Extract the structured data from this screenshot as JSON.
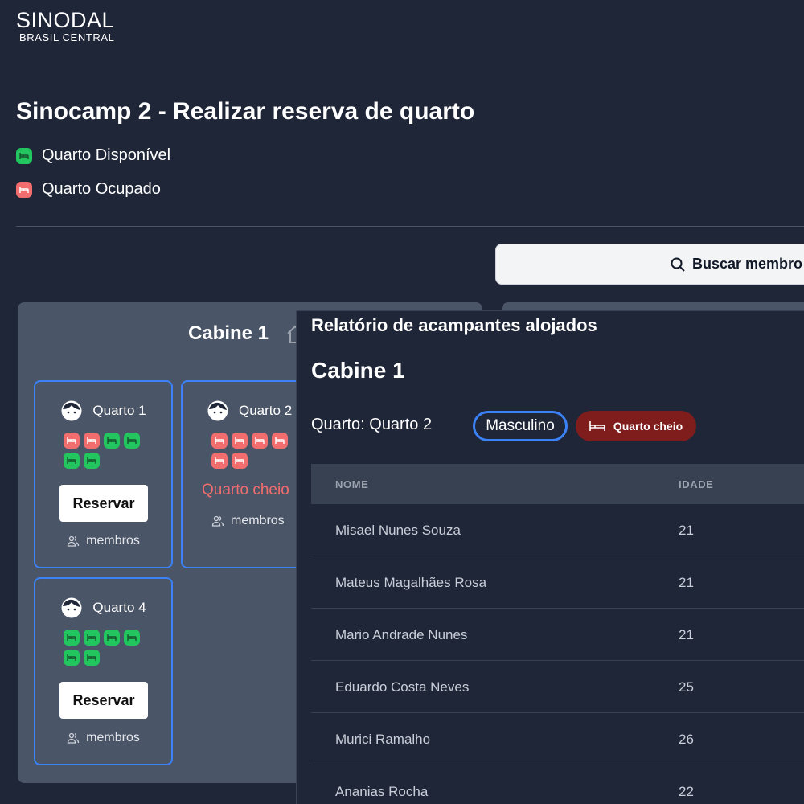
{
  "brand": {
    "name": "SINODAL",
    "sub": "BRASIL CENTRAL"
  },
  "page": {
    "title": "Sinocamp 2 - Realizar reserva de quarto"
  },
  "legend": {
    "available": "Quarto Disponível",
    "occupied": "Quarto Ocupado"
  },
  "colors": {
    "available": "#22c55e",
    "occupied": "#f26d6d",
    "accent": "#3b82f6",
    "full_badge": "#7f1d1d"
  },
  "search": {
    "label": "Buscar membro"
  },
  "cabin": {
    "title": "Cabine 1",
    "rooms": [
      {
        "name": "Quarto 1",
        "beds": [
          "occupied",
          "occupied",
          "available",
          "available",
          "available",
          "available"
        ],
        "reserve_label": "Reservar",
        "members_label": "membros"
      },
      {
        "name": "Quarto 2",
        "beds": [
          "occupied",
          "occupied",
          "occupied",
          "occupied",
          "occupied",
          "occupied"
        ],
        "status_text": "Quarto cheio",
        "members_label": "membros"
      },
      {
        "name": "Quarto 4",
        "beds": [
          "available",
          "available",
          "available",
          "available",
          "available",
          "available"
        ],
        "reserve_label": "Reservar",
        "members_label": "membros"
      }
    ]
  },
  "report": {
    "title": "Relatório de acampantes alojados",
    "cabin": "Cabine 1",
    "room": "Quarto: Quarto 2",
    "gender": "Masculino",
    "status_badge": "Quarto cheio",
    "columns": [
      "NOME",
      "IDADE"
    ],
    "rows": [
      {
        "name": "Misael Nunes Souza",
        "age": "21"
      },
      {
        "name": "Mateus Magalhães Rosa",
        "age": "21"
      },
      {
        "name": "Mario Andrade Nunes",
        "age": "21"
      },
      {
        "name": "Eduardo Costa Neves",
        "age": "25"
      },
      {
        "name": "Murici Ramalho",
        "age": "26"
      },
      {
        "name": "Ananias Rocha",
        "age": "22"
      }
    ]
  }
}
